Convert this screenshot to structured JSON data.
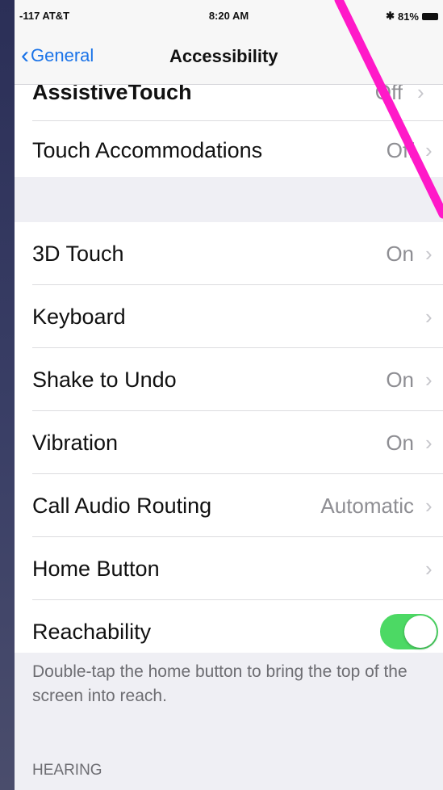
{
  "status_bar": {
    "carrier": "-117 AT&T",
    "time": "8:20 AM",
    "battery": "81%"
  },
  "nav": {
    "back_label": "General",
    "title": "Accessibility"
  },
  "group1": [
    {
      "label": "AssistiveTouch",
      "value": "Off"
    },
    {
      "label": "Touch Accommodations",
      "value": "Off"
    }
  ],
  "group2": [
    {
      "label": "3D Touch",
      "value": "On"
    },
    {
      "label": "Keyboard",
      "value": ""
    },
    {
      "label": "Shake to Undo",
      "value": "On"
    },
    {
      "label": "Vibration",
      "value": "On"
    },
    {
      "label": "Call Audio Routing",
      "value": "Automatic"
    },
    {
      "label": "Home Button",
      "value": ""
    },
    {
      "label": "Reachability",
      "toggle": true
    }
  ],
  "reachability_footnote": "Double-tap the home button to bring the top of the screen into reach.",
  "section_header": "HEARING",
  "colors": {
    "toggle_on": "#4cd964",
    "link": "#1a73e8",
    "annotation": "#ff19c8"
  }
}
